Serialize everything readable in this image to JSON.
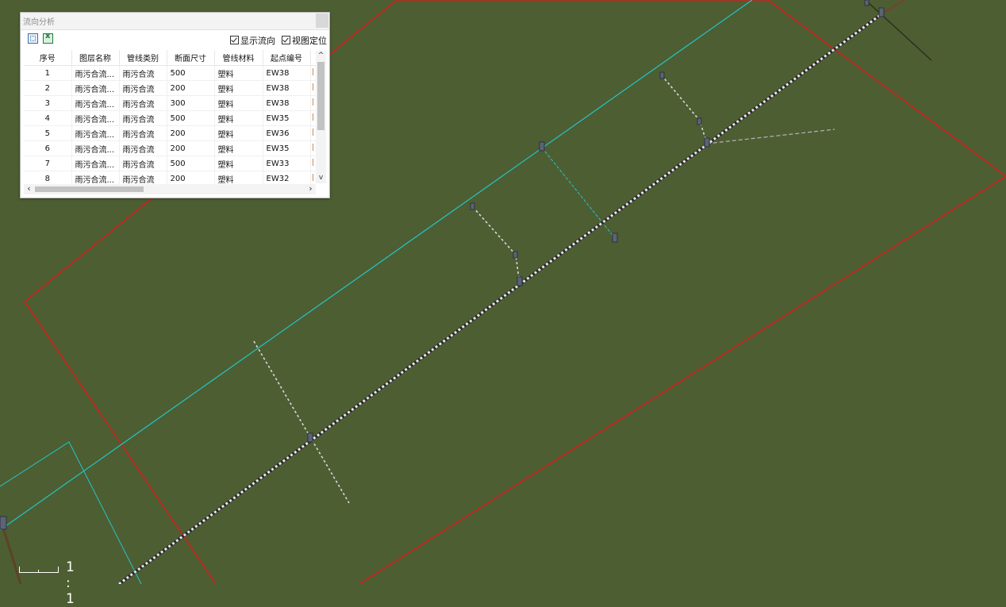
{
  "panel": {
    "title": "流向分析",
    "toolbar": {
      "icons": [
        "locate-icon",
        "excel-export-icon"
      ],
      "show_flow_label": "显示流向",
      "view_locate_label": "视图定位",
      "show_flow_checked": true,
      "view_locate_checked": true
    },
    "columns": [
      "序号",
      "图层名称",
      "管线类别",
      "断面尺寸",
      "管线材料",
      "起点编号"
    ],
    "rows": [
      [
        "1",
        "雨污合流...",
        "雨污合流",
        "500",
        "塑料",
        "EW38"
      ],
      [
        "2",
        "雨污合流...",
        "雨污合流",
        "200",
        "塑料",
        "EW38"
      ],
      [
        "3",
        "雨污合流...",
        "雨污合流",
        "300",
        "塑料",
        "EW38"
      ],
      [
        "4",
        "雨污合流...",
        "雨污合流",
        "500",
        "塑料",
        "EW35"
      ],
      [
        "5",
        "雨污合流...",
        "雨污合流",
        "200",
        "塑料",
        "EW36"
      ],
      [
        "6",
        "雨污合流...",
        "雨污合流",
        "200",
        "塑料",
        "EW35"
      ],
      [
        "7",
        "雨污合流...",
        "雨污合流",
        "500",
        "塑料",
        "EW33"
      ],
      [
        "8",
        "雨污合流...",
        "雨污合流",
        "200",
        "塑料",
        "EW32"
      ]
    ]
  },
  "scale": {
    "ratio": "1 : 1"
  },
  "colors": {
    "ground": "#4d5e33",
    "boundary": "#d0201c",
    "cyan": "#22c6c6",
    "pipe": "#d9d9d9"
  }
}
